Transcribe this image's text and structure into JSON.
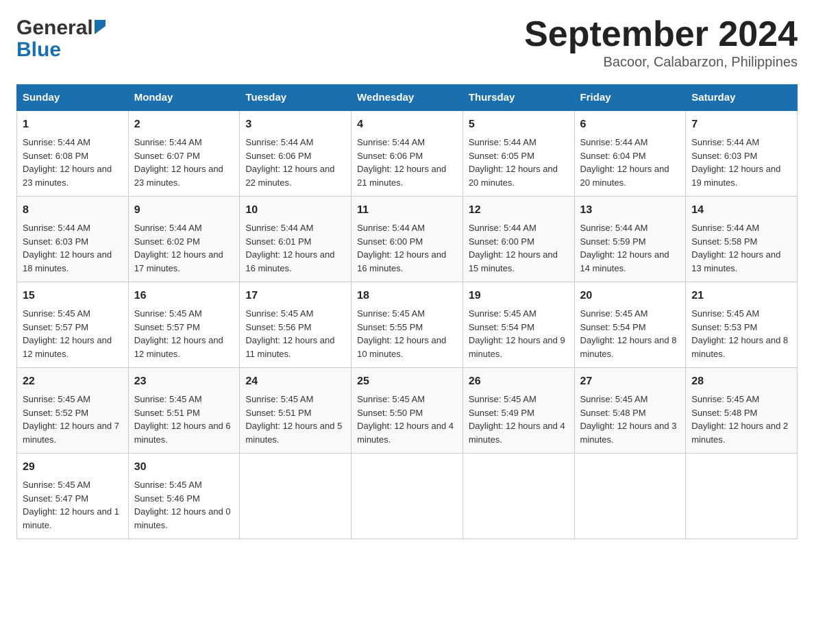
{
  "header": {
    "logo_general": "General",
    "logo_blue": "Blue",
    "month_title": "September 2024",
    "subtitle": "Bacoor, Calabarzon, Philippines"
  },
  "calendar": {
    "days": [
      "Sunday",
      "Monday",
      "Tuesday",
      "Wednesday",
      "Thursday",
      "Friday",
      "Saturday"
    ],
    "weeks": [
      [
        {
          "num": "1",
          "sunrise": "5:44 AM",
          "sunset": "6:08 PM",
          "daylight": "12 hours and 23 minutes."
        },
        {
          "num": "2",
          "sunrise": "5:44 AM",
          "sunset": "6:07 PM",
          "daylight": "12 hours and 23 minutes."
        },
        {
          "num": "3",
          "sunrise": "5:44 AM",
          "sunset": "6:06 PM",
          "daylight": "12 hours and 22 minutes."
        },
        {
          "num": "4",
          "sunrise": "5:44 AM",
          "sunset": "6:06 PM",
          "daylight": "12 hours and 21 minutes."
        },
        {
          "num": "5",
          "sunrise": "5:44 AM",
          "sunset": "6:05 PM",
          "daylight": "12 hours and 20 minutes."
        },
        {
          "num": "6",
          "sunrise": "5:44 AM",
          "sunset": "6:04 PM",
          "daylight": "12 hours and 20 minutes."
        },
        {
          "num": "7",
          "sunrise": "5:44 AM",
          "sunset": "6:03 PM",
          "daylight": "12 hours and 19 minutes."
        }
      ],
      [
        {
          "num": "8",
          "sunrise": "5:44 AM",
          "sunset": "6:03 PM",
          "daylight": "12 hours and 18 minutes."
        },
        {
          "num": "9",
          "sunrise": "5:44 AM",
          "sunset": "6:02 PM",
          "daylight": "12 hours and 17 minutes."
        },
        {
          "num": "10",
          "sunrise": "5:44 AM",
          "sunset": "6:01 PM",
          "daylight": "12 hours and 16 minutes."
        },
        {
          "num": "11",
          "sunrise": "5:44 AM",
          "sunset": "6:00 PM",
          "daylight": "12 hours and 16 minutes."
        },
        {
          "num": "12",
          "sunrise": "5:44 AM",
          "sunset": "6:00 PM",
          "daylight": "12 hours and 15 minutes."
        },
        {
          "num": "13",
          "sunrise": "5:44 AM",
          "sunset": "5:59 PM",
          "daylight": "12 hours and 14 minutes."
        },
        {
          "num": "14",
          "sunrise": "5:44 AM",
          "sunset": "5:58 PM",
          "daylight": "12 hours and 13 minutes."
        }
      ],
      [
        {
          "num": "15",
          "sunrise": "5:45 AM",
          "sunset": "5:57 PM",
          "daylight": "12 hours and 12 minutes."
        },
        {
          "num": "16",
          "sunrise": "5:45 AM",
          "sunset": "5:57 PM",
          "daylight": "12 hours and 12 minutes."
        },
        {
          "num": "17",
          "sunrise": "5:45 AM",
          "sunset": "5:56 PM",
          "daylight": "12 hours and 11 minutes."
        },
        {
          "num": "18",
          "sunrise": "5:45 AM",
          "sunset": "5:55 PM",
          "daylight": "12 hours and 10 minutes."
        },
        {
          "num": "19",
          "sunrise": "5:45 AM",
          "sunset": "5:54 PM",
          "daylight": "12 hours and 9 minutes."
        },
        {
          "num": "20",
          "sunrise": "5:45 AM",
          "sunset": "5:54 PM",
          "daylight": "12 hours and 8 minutes."
        },
        {
          "num": "21",
          "sunrise": "5:45 AM",
          "sunset": "5:53 PM",
          "daylight": "12 hours and 8 minutes."
        }
      ],
      [
        {
          "num": "22",
          "sunrise": "5:45 AM",
          "sunset": "5:52 PM",
          "daylight": "12 hours and 7 minutes."
        },
        {
          "num": "23",
          "sunrise": "5:45 AM",
          "sunset": "5:51 PM",
          "daylight": "12 hours and 6 minutes."
        },
        {
          "num": "24",
          "sunrise": "5:45 AM",
          "sunset": "5:51 PM",
          "daylight": "12 hours and 5 minutes."
        },
        {
          "num": "25",
          "sunrise": "5:45 AM",
          "sunset": "5:50 PM",
          "daylight": "12 hours and 4 minutes."
        },
        {
          "num": "26",
          "sunrise": "5:45 AM",
          "sunset": "5:49 PM",
          "daylight": "12 hours and 4 minutes."
        },
        {
          "num": "27",
          "sunrise": "5:45 AM",
          "sunset": "5:48 PM",
          "daylight": "12 hours and 3 minutes."
        },
        {
          "num": "28",
          "sunrise": "5:45 AM",
          "sunset": "5:48 PM",
          "daylight": "12 hours and 2 minutes."
        }
      ],
      [
        {
          "num": "29",
          "sunrise": "5:45 AM",
          "sunset": "5:47 PM",
          "daylight": "12 hours and 1 minute."
        },
        {
          "num": "30",
          "sunrise": "5:45 AM",
          "sunset": "5:46 PM",
          "daylight": "12 hours and 0 minutes."
        },
        null,
        null,
        null,
        null,
        null
      ]
    ],
    "labels": {
      "sunrise": "Sunrise:",
      "sunset": "Sunset:",
      "daylight": "Daylight:"
    }
  }
}
